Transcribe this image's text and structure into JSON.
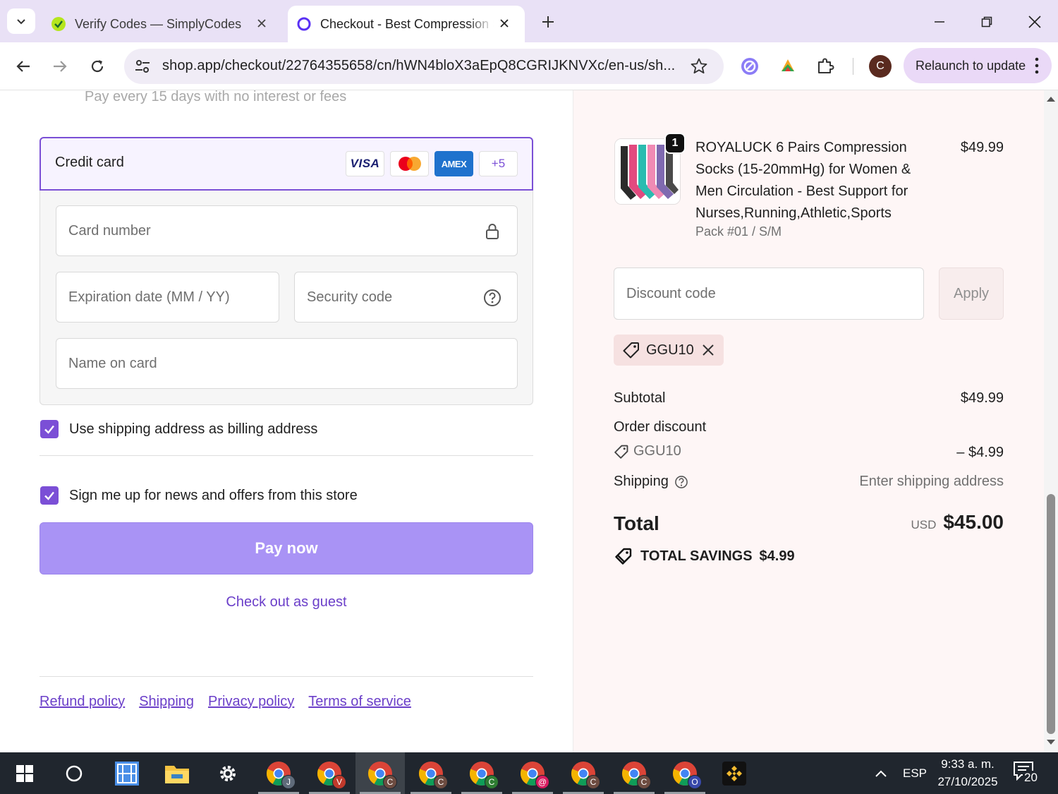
{
  "browser": {
    "tabs": [
      {
        "title": "Verify Codes — SimplyCodes",
        "active": false
      },
      {
        "title": "Checkout - Best Compression Socks",
        "active": true
      }
    ],
    "url": "shop.app/checkout/22764355658/cn/hWN4bloX3aEpQ8CGRIJKNVXc/en-us/sh...",
    "avatar_letter": "C",
    "relaunch_label": "Relaunch to update",
    "accent_color": "#e9e1f6"
  },
  "payment": {
    "pay_every_text": "Pay every 15 days with no interest or fees",
    "credit_card_title": "Credit card",
    "brands": {
      "visa": "VISA",
      "amex": "AMEX",
      "more": "+5"
    },
    "fields": {
      "card_number": "Card number",
      "expiration": "Expiration date (MM / YY)",
      "security_code": "Security code",
      "name_on_card": "Name on card"
    },
    "use_shipping_label": "Use shipping address as billing address",
    "use_shipping_checked": true,
    "newsletter_label": "Sign me up for news and offers from this store",
    "newsletter_checked": true,
    "pay_now_label": "Pay now",
    "guest_label": "Check out as guest",
    "accent_color": "#7b4fd6",
    "footer_links": [
      "Refund policy",
      "Shipping",
      "Privacy policy",
      "Terms of service"
    ]
  },
  "summary": {
    "product": {
      "name": "ROYALUCK 6 Pairs Compression Socks (15-20mmHg) for Women & Men Circulation - Best Support for Nurses,Running,Athletic,Sports",
      "variant": "Pack #01 / S/M",
      "price": "$49.99",
      "quantity": "1"
    },
    "discount_placeholder": "Discount code",
    "apply_label": "Apply",
    "applied_code": "GGU10",
    "subtotal_label": "Subtotal",
    "subtotal_value": "$49.99",
    "order_discount_label": "Order discount",
    "discount_code": "GGU10",
    "discount_value": "– $4.99",
    "shipping_label": "Shipping",
    "shipping_value": "Enter shipping address",
    "total_label": "Total",
    "total_currency": "USD",
    "total_value": "$45.00",
    "savings_label": "TOTAL SAVINGS",
    "savings_value": "$4.99"
  },
  "taskbar": {
    "chrome_badges": [
      "J",
      "V",
      "C",
      "C",
      "C",
      "@",
      "C",
      "C",
      "O"
    ],
    "language": "ESP",
    "time": "9:33 a. m.",
    "date": "27/10/2025",
    "notification_count": "20"
  }
}
